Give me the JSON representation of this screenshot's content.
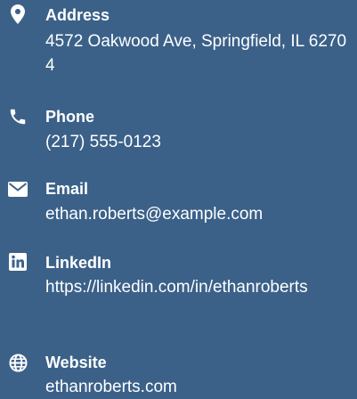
{
  "contacts": [
    {
      "icon": "map-pin-icon",
      "label": "Address",
      "value": "4572 Oakwood Ave, Springfield, IL 62704"
    },
    {
      "icon": "phone-icon",
      "label": "Phone",
      "value": "(217) 555-0123"
    },
    {
      "icon": "envelope-icon",
      "label": "Email",
      "value": "ethan.roberts@example.com"
    },
    {
      "icon": "linkedin-icon",
      "label": "LinkedIn",
      "value": "https://linkedin.com/in/ethanroberts"
    },
    {
      "icon": "globe-icon",
      "label": "Website",
      "value": "ethanroberts.com"
    }
  ]
}
